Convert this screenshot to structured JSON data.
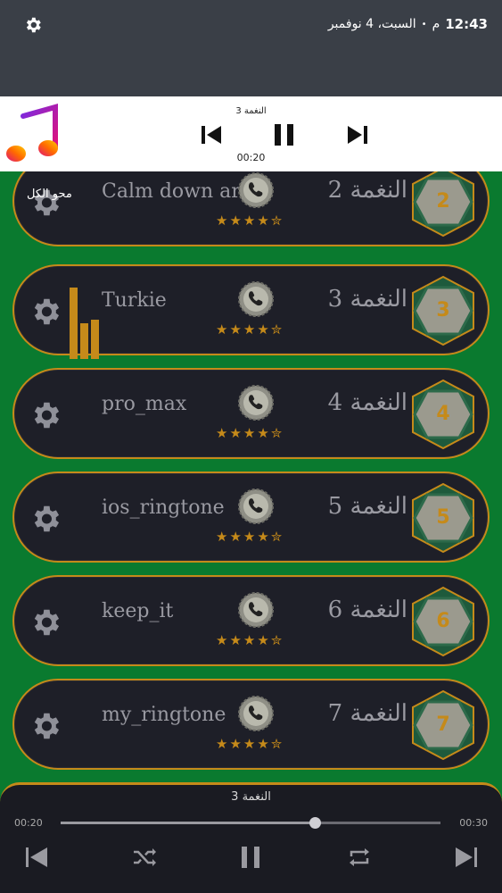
{
  "status_bar": {
    "time": "12:43",
    "ampm": "م",
    "separator": "•",
    "date": "السبت، 4 نوفمبر",
    "settings_icon": "gear-icon"
  },
  "media_notification": {
    "title": "النغمة 3",
    "elapsed": "00:20",
    "app_icon": "music-note-icon"
  },
  "list": {
    "clear_all_label": "محو الكل",
    "rows": [
      {
        "number": "2",
        "label": "النغمة 2",
        "name": "Calm down arab",
        "rating": "★★★★✮"
      },
      {
        "number": "3",
        "label": "النغمة 3",
        "name": "Turkie",
        "rating": "★★★★✮"
      },
      {
        "number": "4",
        "label": "النغمة 4",
        "name": "pro_max",
        "rating": "★★★★✮"
      },
      {
        "number": "5",
        "label": "النغمة 5",
        "name": "ios_ringtone",
        "rating": "★★★★✮"
      },
      {
        "number": "6",
        "label": "النغمة 6",
        "name": "keep_it",
        "rating": "★★★★✮"
      },
      {
        "number": "7",
        "label": "النغمة 7",
        "name": "my_ringtone",
        "rating": "★★★★✮"
      }
    ]
  },
  "player": {
    "title": "النغمة 3",
    "elapsed": "00:20",
    "duration": "00:30",
    "progress": 0.67
  },
  "colors": {
    "accent": "#c58a1a",
    "background": "#0a7a2f",
    "row_bg": "#1e1f28"
  }
}
